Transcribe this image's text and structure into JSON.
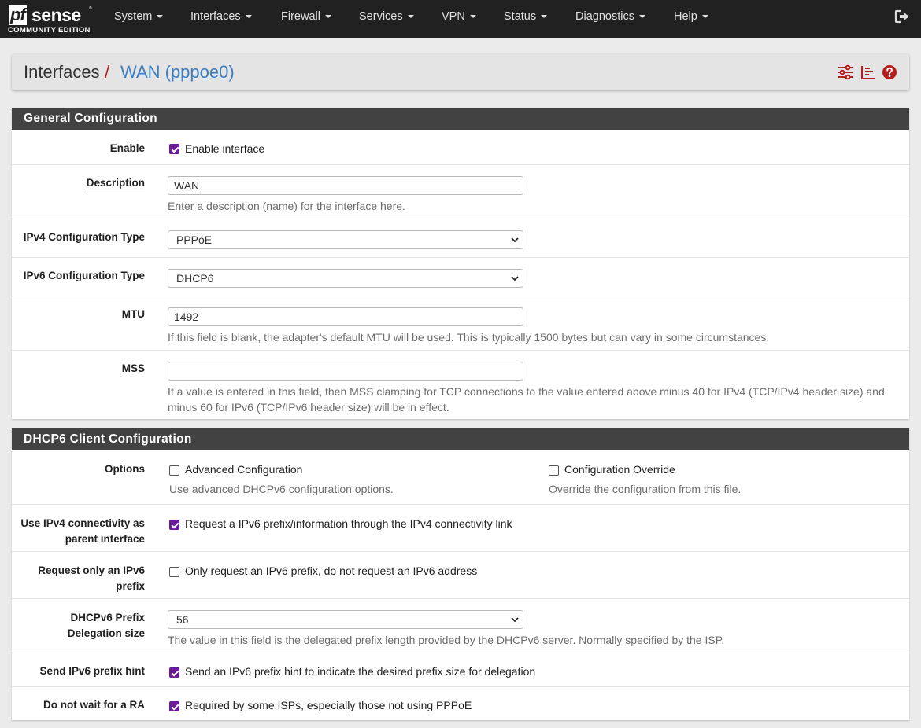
{
  "logo": {
    "pf": "pf",
    "sense": "sense",
    "tm": "®",
    "edition": "COMMUNITY EDITION"
  },
  "nav": [
    "System",
    "Interfaces",
    "Firewall",
    "Services",
    "VPN",
    "Status",
    "Diagnostics",
    "Help"
  ],
  "breadcrumb": {
    "root": "Interfaces",
    "separator": "/",
    "page": "WAN (pppoe0)"
  },
  "header_icons": [
    "sliders-icon",
    "list-chart-icon",
    "help-icon"
  ],
  "colors": {
    "navbar": "#212121",
    "accent_purple": "#6a1b9a",
    "link_blue": "#3d7ebf",
    "heading_bg": "#424242",
    "help_red": "#b71c1c"
  },
  "general": {
    "title": "General Configuration",
    "enable": {
      "label": "Enable",
      "text": "Enable interface",
      "checked": true
    },
    "description": {
      "label": "Description",
      "value": "WAN",
      "help": "Enter a description (name) for the interface here."
    },
    "ipv4_type": {
      "label": "IPv4 Configuration Type",
      "value": "PPPoE"
    },
    "ipv6_type": {
      "label": "IPv6 Configuration Type",
      "value": "DHCP6"
    },
    "mtu": {
      "label": "MTU",
      "value": "1492",
      "help": "If this field is blank, the adapter's default MTU will be used. This is typically 1500 bytes but can vary in some circumstances."
    },
    "mss": {
      "label": "MSS",
      "value": "",
      "help_1": "If a value is entered in this field, then MSS clamping for TCP connections to the value entered above minus 40 for IPv4 (TCP/IPv4 header size) and",
      "help_2": "minus 60 for IPv6 (TCP/IPv6 header size) will be in effect."
    }
  },
  "dhcp6": {
    "title": "DHCP6 Client Configuration",
    "options": {
      "label": "Options",
      "advanced": {
        "text": "Advanced Configuration",
        "help": "Use advanced DHCPv6 configuration options.",
        "checked": false
      },
      "override": {
        "text": "Configuration Override",
        "help": "Override the configuration from this file.",
        "checked": false
      }
    },
    "use_ipv4": {
      "label_1": "Use IPv4 connectivity as",
      "label_2": "parent interface",
      "text": "Request a IPv6 prefix/information through the IPv4 connectivity link",
      "checked": true
    },
    "request_only": {
      "label_1": "Request only an IPv6",
      "label_2": "prefix",
      "text": "Only request an IPv6 prefix, do not request an IPv6 address",
      "checked": false
    },
    "prefix_size": {
      "label_1": "DHCPv6 Prefix",
      "label_2": "Delegation size",
      "value": "56",
      "help": "The value in this field is the delegated prefix length provided by the DHCPv6 server. Normally specified by the ISP."
    },
    "prefix_hint": {
      "label": "Send IPv6 prefix hint",
      "text": "Send an IPv6 prefix hint to indicate the desired prefix size for delegation",
      "checked": true
    },
    "no_wait_ra": {
      "label": "Do not wait for a RA",
      "text": "Required by some ISPs, especially those not using PPPoE",
      "checked": true
    }
  }
}
